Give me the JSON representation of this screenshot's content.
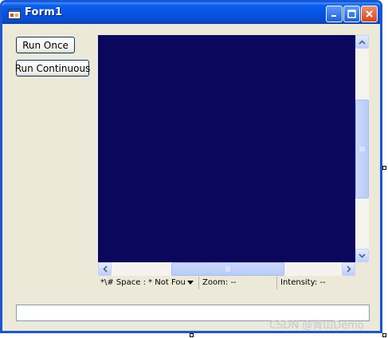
{
  "window": {
    "title": "Form1"
  },
  "icons": {
    "app": "form-app-icon",
    "minimize": "minimize-icon",
    "maximize": "maximize-icon",
    "close": "close-icon"
  },
  "controls": {
    "run_once_label": "Run Once",
    "run_continuous_label": "Run Continuous"
  },
  "display": {
    "background_color": "#0b075c"
  },
  "statusbar": {
    "space_combo_value": "*\\# Space : * Not Fou",
    "zoom_text": "Zoom:  --",
    "intensity_text": "Intensity: --"
  },
  "output_box": {
    "value": ""
  },
  "watermark": {
    "text": "CSDN @青山Demo"
  }
}
